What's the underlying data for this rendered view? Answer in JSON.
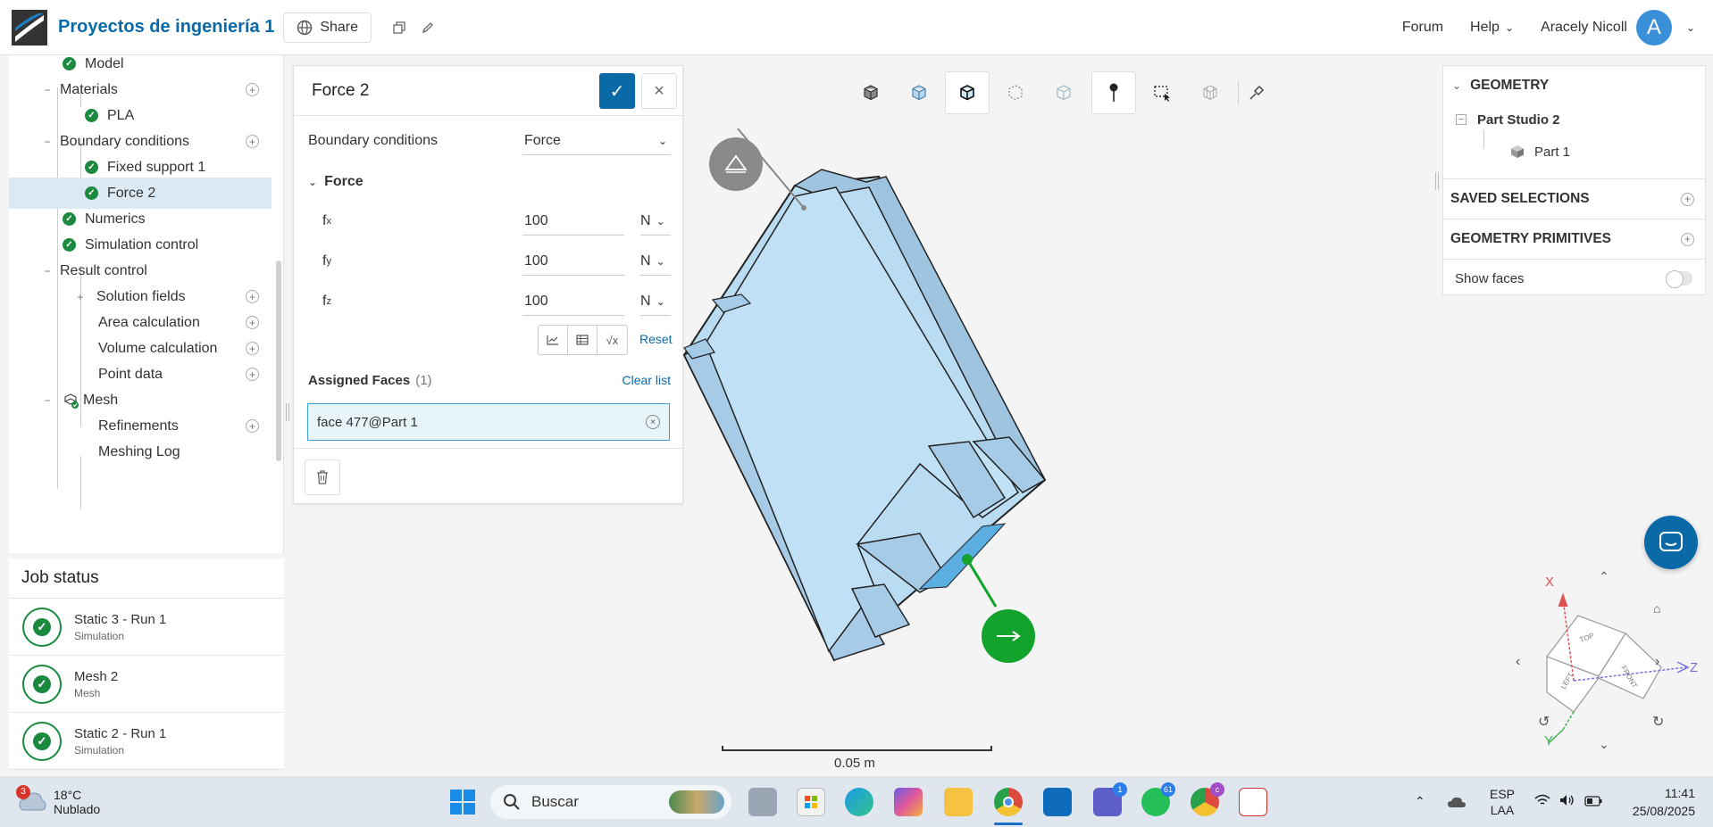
{
  "header": {
    "project_title": "Proyectos de ingeniería 1",
    "share_label": "Share",
    "forum_label": "Forum",
    "help_label": "Help",
    "user_name": "Aracely Nicoll",
    "avatar_letter": "A"
  },
  "tree": {
    "items": [
      {
        "label": "Model"
      },
      {
        "label": "Materials"
      },
      {
        "label": "PLA"
      },
      {
        "label": "Boundary conditions"
      },
      {
        "label": "Fixed support 1"
      },
      {
        "label": "Force 2"
      },
      {
        "label": "Numerics"
      },
      {
        "label": "Simulation control"
      },
      {
        "label": "Result control"
      },
      {
        "label": "Solution fields"
      },
      {
        "label": "Area calculation"
      },
      {
        "label": "Volume calculation"
      },
      {
        "label": "Point data"
      },
      {
        "label": "Mesh"
      },
      {
        "label": "Refinements"
      },
      {
        "label": "Meshing Log"
      }
    ]
  },
  "jobs": {
    "title": "Job status",
    "items": [
      {
        "name": "Static 3 - Run 1",
        "type": "Simulation"
      },
      {
        "name": "Mesh 2",
        "type": "Mesh"
      },
      {
        "name": "Static 2 - Run 1",
        "type": "Simulation"
      }
    ]
  },
  "panel": {
    "title": "Force 2",
    "bc_label": "Boundary conditions",
    "bc_value": "Force",
    "section_label": "Force",
    "fx_label": "f",
    "fx_sub": "x",
    "fx_value": "100",
    "fx_unit": "N",
    "fy_label": "f",
    "fy_sub": "y",
    "fy_value": "100",
    "fy_unit": "N",
    "fz_label": "f",
    "fz_sub": "z",
    "fz_value": "100",
    "fz_unit": "N",
    "reset_label": "Reset",
    "assigned_label": "Assigned Faces",
    "assigned_count": "(1)",
    "clear_label": "Clear list",
    "face_value": "face 477@Part 1",
    "fn_sqrt_label": "√x"
  },
  "geometry": {
    "section_title": "GEOMETRY",
    "studio": "Part Studio 2",
    "part": "Part 1",
    "saved_selections": "SAVED SELECTIONS",
    "primitives": "GEOMETRY PRIMITIVES",
    "show_faces": "Show faces",
    "show_faces_on": false
  },
  "viewer": {
    "scale_label": "0.05 m",
    "axis_x": "X",
    "axis_y": "Y",
    "axis_z": "Z",
    "cube_top": "TOP",
    "cube_front": "FRONT",
    "cube_left": "LEFT",
    "part_color": "#b9dcf2",
    "force_color": "#12a32c"
  },
  "taskbar": {
    "weather_badge": "3",
    "temperature": "18°C",
    "weather": "Nublado",
    "search_placeholder": "Buscar",
    "teams_badge": "1",
    "whatsapp_badge": "61",
    "chrome_badge": "c",
    "lang1": "ESP",
    "lang2": "LAA",
    "time": "11:41",
    "date": "25/08/2025"
  },
  "colors": {
    "accent": "#0a6aa8",
    "success": "#1b8a3e"
  }
}
